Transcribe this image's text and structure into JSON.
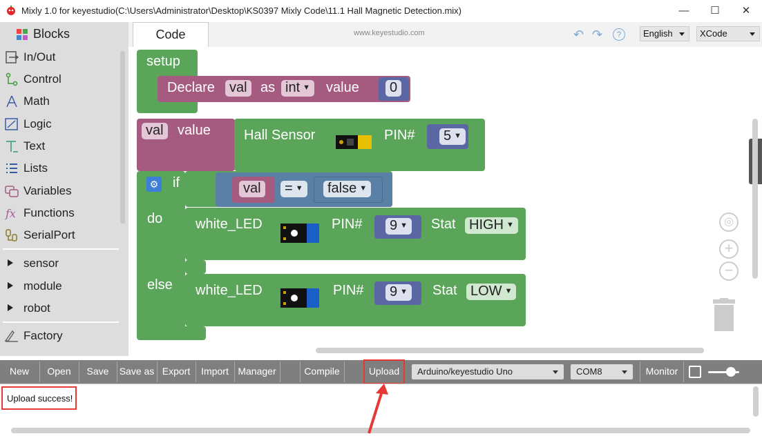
{
  "window": {
    "title": "Mixly 1.0 for keyestudio(C:\\Users\\Administrator\\Desktop\\KS0397 Mixly Code\\11.1 Hall Magnetic Detection.mix)"
  },
  "sidebar": {
    "header": "Blocks",
    "categories": [
      {
        "label": "In/Out",
        "icon": "inout-icon"
      },
      {
        "label": "Control",
        "icon": "control-icon"
      },
      {
        "label": "Math",
        "icon": "math-icon"
      },
      {
        "label": "Logic",
        "icon": "logic-icon"
      },
      {
        "label": "Text",
        "icon": "text-icon"
      },
      {
        "label": "Lists",
        "icon": "lists-icon"
      },
      {
        "label": "Variables",
        "icon": "variables-icon"
      },
      {
        "label": "Functions",
        "icon": "functions-icon"
      },
      {
        "label": "SerialPort",
        "icon": "serialport-icon"
      }
    ],
    "groups": [
      "sensor",
      "module",
      "robot"
    ],
    "factory": "Factory"
  },
  "header": {
    "tab": "Code",
    "url": "www.keyestudio.com",
    "language": "English",
    "theme": "XCode"
  },
  "workspace": {
    "setup": {
      "label": "setup",
      "declare": "Declare",
      "var": "val",
      "as": "as",
      "type": "int",
      "value_label": "value",
      "value": "0"
    },
    "assign": {
      "var": "val",
      "value_label": "value",
      "sensor": "Hall Sensor",
      "pin_label": "PIN#",
      "pin": "5"
    },
    "ifblock": {
      "if_label": "if",
      "var": "val",
      "op": "=",
      "cmp": "false",
      "do_label": "do",
      "else_label": "else"
    },
    "led_do": {
      "name": "white_LED",
      "pin_label": "PIN#",
      "pin": "9",
      "stat_label": "Stat",
      "stat": "HIGH"
    },
    "led_else": {
      "name": "white_LED",
      "pin_label": "PIN#",
      "pin": "9",
      "stat_label": "Stat",
      "stat": "LOW"
    }
  },
  "toolbar": {
    "new": "New",
    "open": "Open",
    "save": "Save",
    "save_as": "Save as",
    "export": "Export",
    "import": "Import",
    "manager": "Manager",
    "compile": "Compile",
    "upload": "Upload",
    "board": "Arduino/keyestudio Uno",
    "port": "COM8",
    "monitor": "Monitor"
  },
  "output": {
    "message": "Upload success!"
  },
  "colors": {
    "procedure_green": "#5ba55b",
    "variable_pink": "#a55b80",
    "math_blue": "#5b67a5",
    "logic_blue": "#5b80a5",
    "annotation_red": "#e53935"
  }
}
